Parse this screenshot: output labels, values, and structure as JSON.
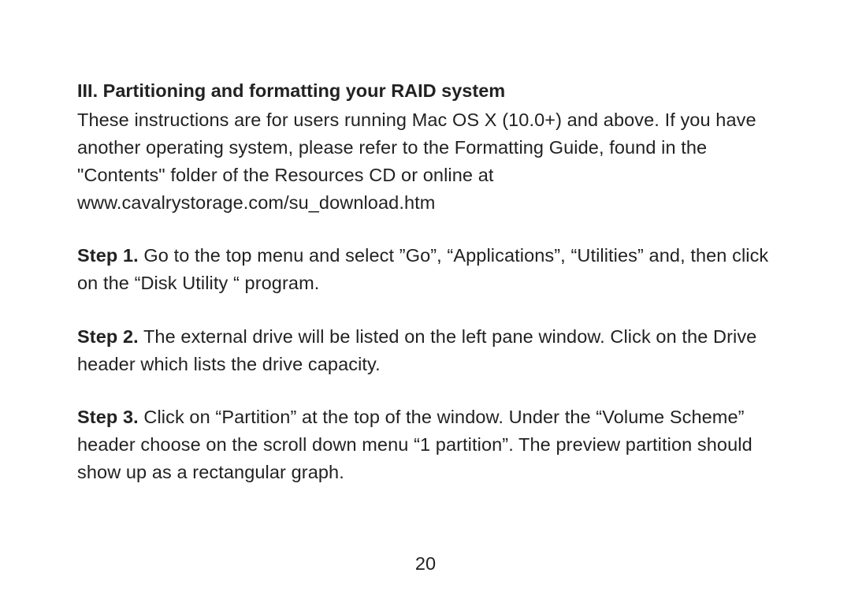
{
  "heading": "III. Partitioning and formatting your RAID system",
  "intro": "These instructions are for users running Mac OS X (10.0+) and above. If you have another operating system, please refer to the Formatting Guide, found in the \"Contents\" folder of the Resources CD or online at www.cavalrystorage.com/su_download.htm",
  "steps": [
    {
      "label": "Step 1.",
      "text": " Go to the top menu and select ”Go”, “Applications”, “Utilities” and, then click on the “Disk Utility “ program."
    },
    {
      "label": "Step 2.",
      "text": " The external drive will be listed on the left pane window. Click on the Drive header which lists the drive capacity."
    },
    {
      "label": "Step 3.",
      "text": " Click on “Partition” at the top of the window. Under the “Volume Scheme” header choose on the scroll down menu “1 partition”. The preview partition should show up as a rectangular graph."
    }
  ],
  "pageNumber": "20"
}
